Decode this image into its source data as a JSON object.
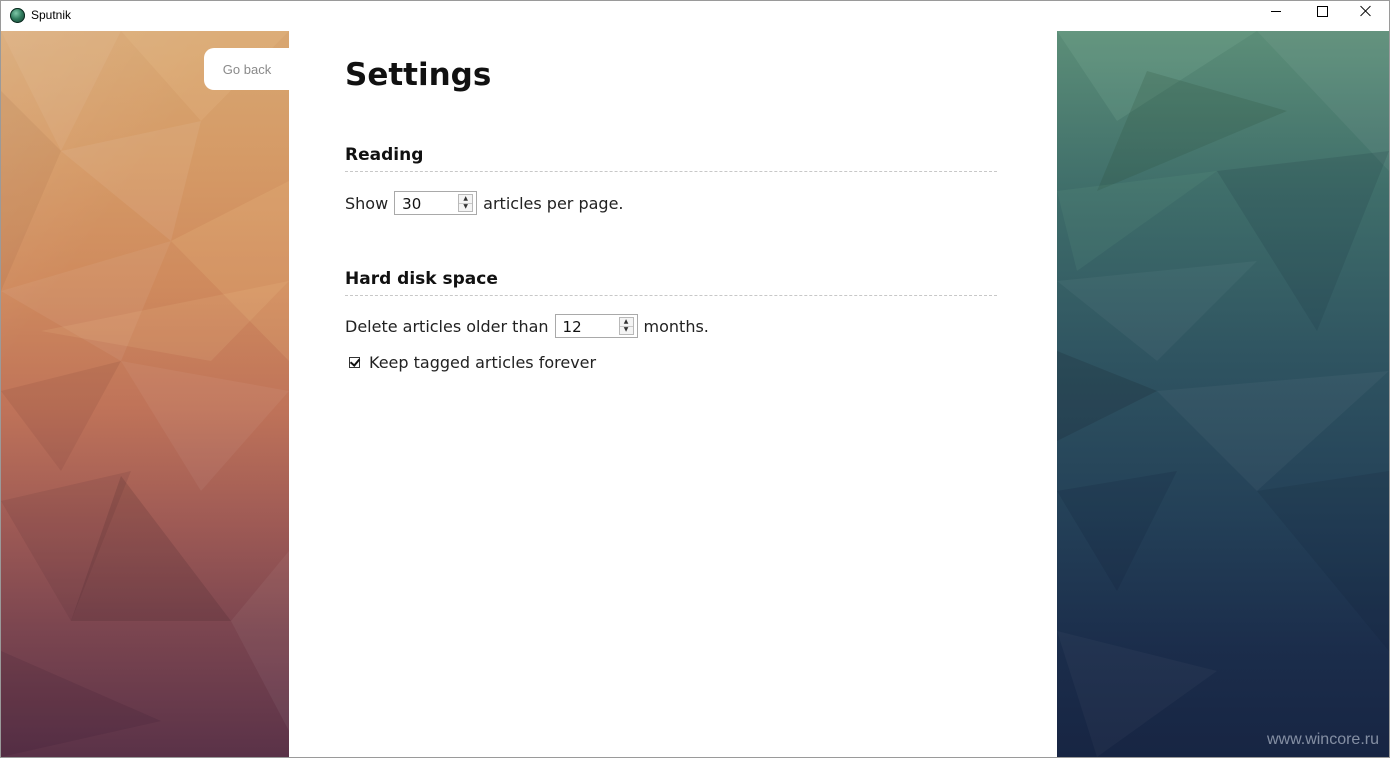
{
  "window": {
    "title": "Sputnik",
    "app_icon": "sputnik-globe-icon",
    "controls": [
      "minimize-icon",
      "maximize-icon",
      "close-icon"
    ]
  },
  "nav": {
    "go_back_label": "Go back"
  },
  "settings": {
    "title": "Settings",
    "reading": {
      "heading": "Reading",
      "prefix": "Show",
      "articles_per_page": "30",
      "suffix": "articles per page."
    },
    "disk": {
      "heading": "Hard disk space",
      "prefix": "Delete articles older than",
      "months": "12",
      "suffix": "months.",
      "keep_tagged_label": "Keep tagged articles forever",
      "keep_tagged_checked": true
    }
  },
  "watermark": "www.wincore.ru",
  "colors": {
    "left_panel_top": "#d8a772",
    "left_panel_bottom": "#5a3248",
    "right_panel_top": "#5c8e78",
    "right_panel_bottom": "#172543"
  }
}
